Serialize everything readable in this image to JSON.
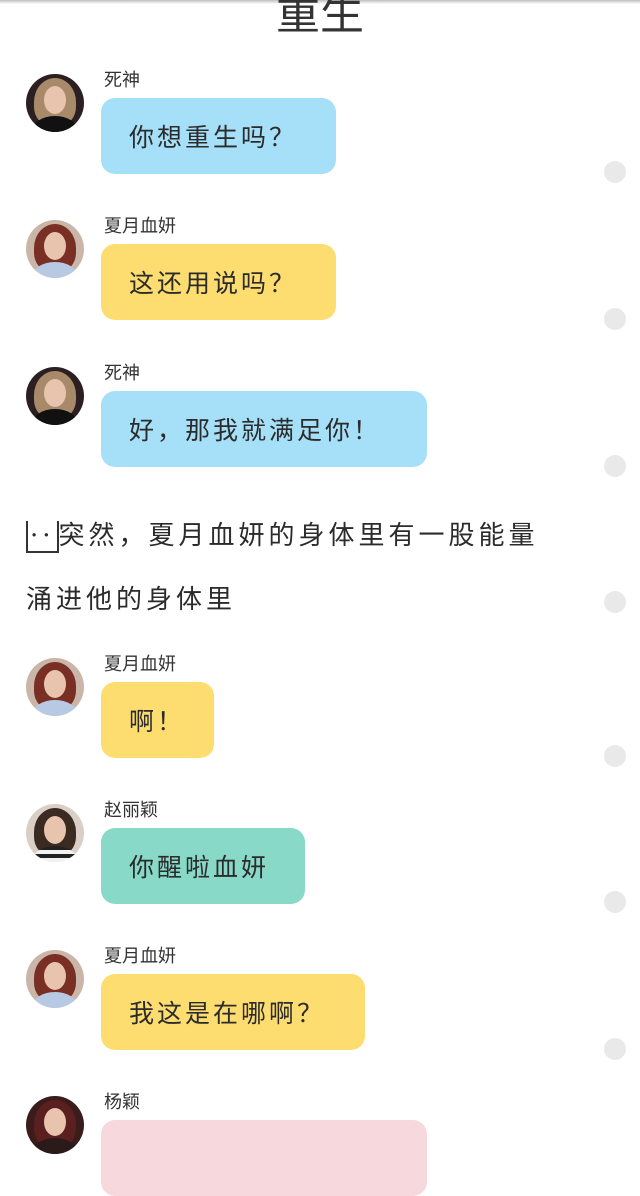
{
  "page": {
    "title": "重生"
  },
  "colors": {
    "death": "#a6dff8",
    "xiayue": "#fddd70",
    "zhaoliying": "#89d9c9",
    "yangying": "#f7d9dd"
  },
  "messages": [
    {
      "speaker": "死神",
      "text": "你想重生吗？",
      "bubble_color": "blue",
      "avatar": "avatar-dark-hair-icon"
    },
    {
      "speaker": "夏月血妍",
      "text": "这还用说吗？",
      "bubble_color": "yellow",
      "avatar": "avatar-red-hair-icon"
    },
    {
      "speaker": "死神",
      "text": "好，那我就满足你！",
      "bubble_color": "blue",
      "avatar": "avatar-dark-hair-icon"
    },
    {
      "speaker": "夏月血妍",
      "text": "啊！",
      "bubble_color": "yellow",
      "avatar": "avatar-red-hair-icon"
    },
    {
      "speaker": "赵丽颖",
      "text": "你醒啦血妍",
      "bubble_color": "teal",
      "avatar": "avatar-striped-shirt-icon"
    },
    {
      "speaker": "夏月血妍",
      "text": "我这是在哪啊？",
      "bubble_color": "yellow",
      "avatar": "avatar-red-hair-icon"
    },
    {
      "speaker": "杨颖",
      "text": "",
      "bubble_color": "pink",
      "avatar": "avatar-dark-red-hair-icon"
    }
  ],
  "narration": {
    "ellipsis": "··",
    "line1": "突然，夏月血妍的身体里有一股能量",
    "line2": "涌进他的身体里"
  }
}
